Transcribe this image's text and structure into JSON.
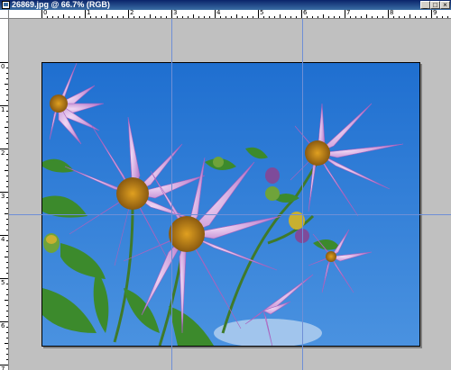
{
  "window": {
    "title": "26869.jpg @ 66.7% (RGB)",
    "minimize_icon": "minimize-icon",
    "maximize_icon": "maximize-icon",
    "close_icon": "close-icon"
  },
  "ruler": {
    "top_labels": [
      "0",
      "1",
      "2",
      "3",
      "4",
      "5",
      "6",
      "7",
      "8",
      "9"
    ],
    "left_labels": [
      "0",
      "1",
      "2",
      "3",
      "4",
      "5",
      "6",
      "7"
    ]
  },
  "document": {
    "image_description_icon": "photo-purple-dahlias",
    "zoom": "66.7%",
    "color_mode": "RGB"
  },
  "colors": {
    "sky": "#2a7bd8",
    "petal": "#c98ad6",
    "guide": "#6f8fd6",
    "canvas_bg": "#c0c0c0"
  }
}
